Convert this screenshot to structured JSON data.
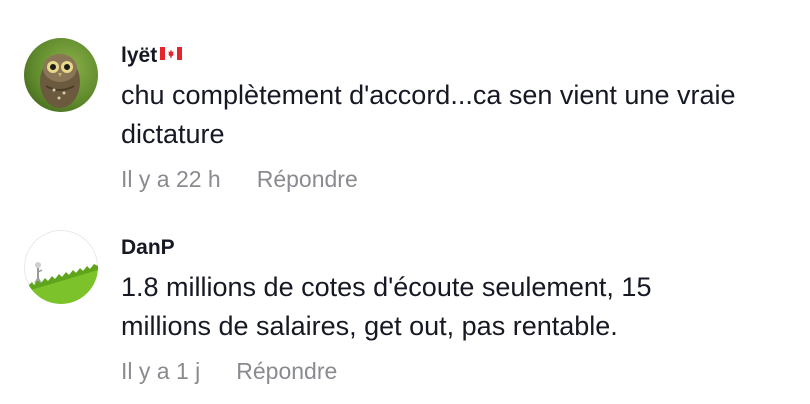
{
  "comments": [
    {
      "username": "lyët",
      "flag_icon": "canada-flag-icon",
      "text_line1": "chu complètement d'accord...ca sen vient une vraie",
      "text_line2": "dictature",
      "time": "Il y a 22 h",
      "reply_label": "Répondre"
    },
    {
      "username": "DanP",
      "text_line1": "1.8 millions de cotes d'écoute seulement, 15",
      "text_line2": "millions de salaires, get out, pas rentable.",
      "time": "Il y a 1 j",
      "reply_label": "Répondre"
    }
  ],
  "colors": {
    "text": "#161823",
    "meta": "#8a8b91",
    "flag_red": "#e5252a"
  }
}
